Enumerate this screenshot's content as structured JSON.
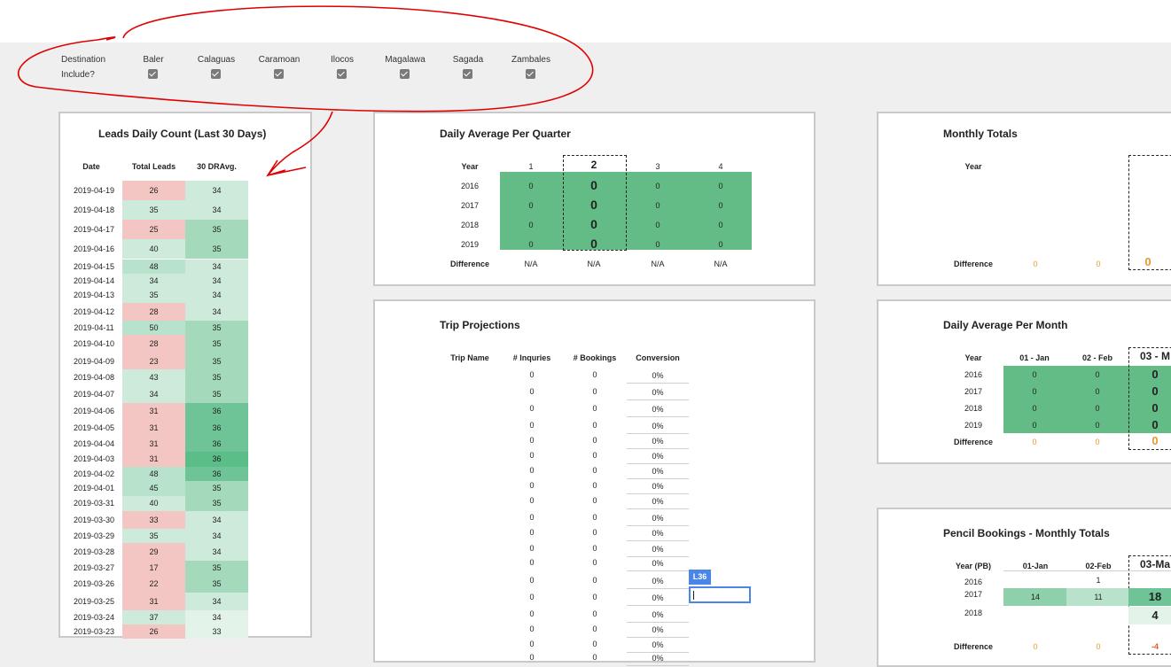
{
  "filters": {
    "destination_label": "Destination",
    "include_label": "Include?",
    "destinations": [
      "Baler",
      "Calaguas",
      "Caramoan",
      "Ilocos",
      "Magalawa",
      "Sagada",
      "Zambales"
    ]
  },
  "leads": {
    "title": "Leads Daily Count (Last 30 Days)",
    "headers": [
      "Date",
      "Total Leads",
      "30 DRAvg."
    ],
    "rows": [
      [
        "2019-04-19",
        "26",
        "34"
      ],
      [
        "2019-04-18",
        "35",
        "34"
      ],
      [
        "2019-04-17",
        "25",
        "35"
      ],
      [
        "2019-04-16",
        "40",
        "35"
      ],
      [
        "2019-04-15",
        "48",
        "34"
      ],
      [
        "2019-04-14",
        "34",
        "34"
      ],
      [
        "2019-04-13",
        "35",
        "34"
      ],
      [
        "2019-04-12",
        "28",
        "34"
      ],
      [
        "2019-04-11",
        "50",
        "35"
      ],
      [
        "2019-04-10",
        "28",
        "35"
      ],
      [
        "2019-04-09",
        "23",
        "35"
      ],
      [
        "2019-04-08",
        "43",
        "35"
      ],
      [
        "2019-04-07",
        "34",
        "35"
      ],
      [
        "2019-04-06",
        "31",
        "36"
      ],
      [
        "2019-04-05",
        "31",
        "36"
      ],
      [
        "2019-04-04",
        "31",
        "36"
      ],
      [
        "2019-04-03",
        "31",
        "36"
      ],
      [
        "2019-04-02",
        "48",
        "36"
      ],
      [
        "2019-04-01",
        "45",
        "35"
      ],
      [
        "2019-03-31",
        "40",
        "35"
      ],
      [
        "2019-03-30",
        "33",
        "34"
      ],
      [
        "2019-03-29",
        "35",
        "34"
      ],
      [
        "2019-03-28",
        "29",
        "34"
      ],
      [
        "2019-03-27",
        "17",
        "35"
      ],
      [
        "2019-03-26",
        "22",
        "35"
      ],
      [
        "2019-03-25",
        "31",
        "34"
      ],
      [
        "2019-03-24",
        "37",
        "34"
      ],
      [
        "2019-03-23",
        "26",
        "33"
      ]
    ]
  },
  "quarter": {
    "title": "Daily Average Per Quarter",
    "year_label": "Year",
    "quarters": [
      "1",
      "2",
      "3",
      "4"
    ],
    "years": [
      "2016",
      "2017",
      "2018",
      "2019"
    ],
    "value": "0",
    "difference_label": "Difference",
    "difference": [
      "N/A",
      "N/A",
      "N/A",
      "N/A"
    ]
  },
  "trips": {
    "title": "Trip Projections",
    "headers": [
      "Trip Name",
      "# Inquries",
      "# Bookings",
      "Conversion"
    ],
    "rows": 19,
    "inq": "0",
    "book": "0",
    "conv": "0%"
  },
  "monthly_totals": {
    "title": "Monthly Totals",
    "year_label": "Year",
    "difference_label": "Difference",
    "difference": [
      "0",
      "0",
      "0"
    ]
  },
  "daily_month": {
    "title": "Daily Average Per Month",
    "year_label": "Year",
    "months": [
      "01 - Jan",
      "02 - Feb",
      "03 - M"
    ],
    "years": [
      "2016",
      "2017",
      "2018",
      "2019"
    ],
    "value": "0",
    "difference_label": "Difference",
    "difference": [
      "0",
      "0",
      "0"
    ]
  },
  "pencil": {
    "title": "Pencil Bookings - Monthly Totals",
    "year_label": "Year (PB)",
    "months": [
      "01-Jan",
      "02-Feb",
      "03-Ma"
    ],
    "years": [
      "2016",
      "2017",
      "2018"
    ],
    "r2016": [
      "",
      "1",
      ""
    ],
    "r2017": [
      "14",
      "11",
      "18"
    ],
    "r2018": [
      "",
      "",
      "4"
    ],
    "difference_label": "Difference",
    "difference": [
      "0",
      "0",
      "-4"
    ]
  },
  "active_cell": {
    "ref": "L36"
  },
  "colors": {
    "green": "#63bc85",
    "red": "#f3c6c3",
    "accent": "#4a86e8",
    "annotation": "#e00000"
  }
}
